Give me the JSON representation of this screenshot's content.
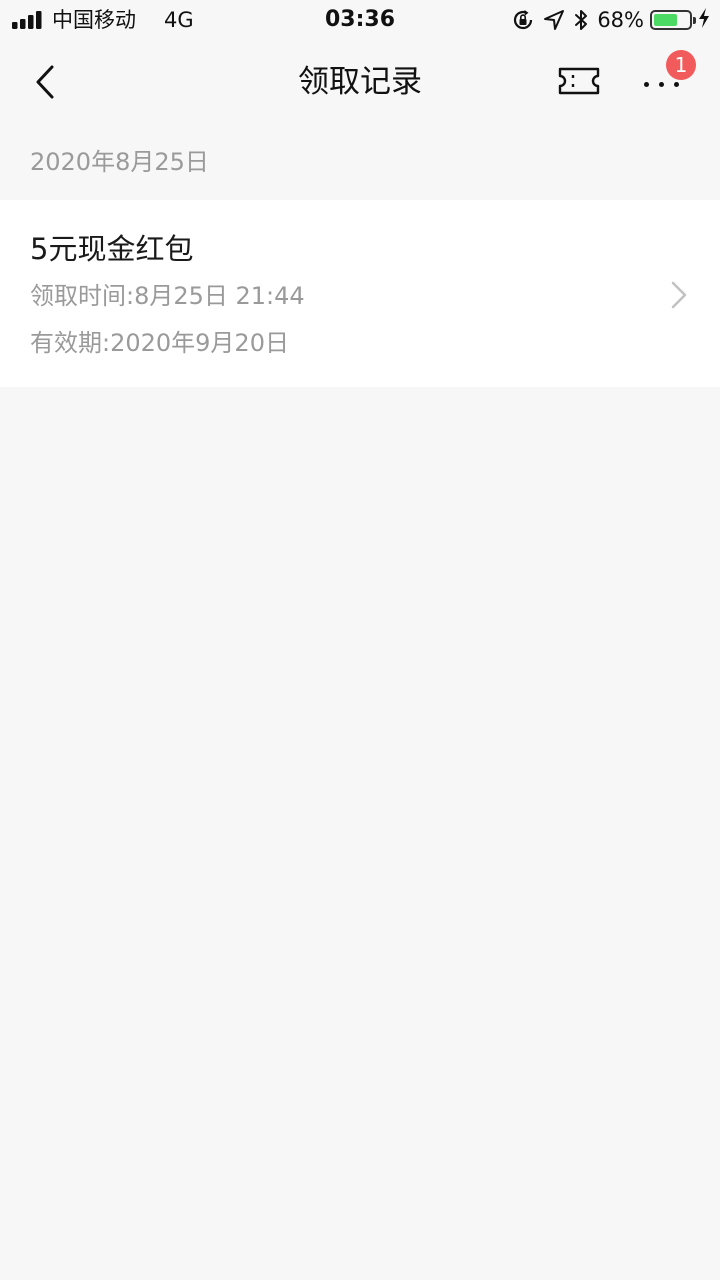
{
  "status_bar": {
    "carrier": "中国移动",
    "network": "4G",
    "time": "03:36",
    "battery_percent": "68%",
    "battery_level": 0.68,
    "battery_color": "#4cd964",
    "icons": [
      "signal-icon",
      "rotation-lock-icon",
      "location-arrow-icon",
      "bluetooth-icon",
      "battery-icon",
      "charging-icon"
    ]
  },
  "nav": {
    "title": "领取记录",
    "back_icon": "chevron-left-icon",
    "ticket_icon": "ticket-icon",
    "more_icon": "more-dots-icon",
    "badge_count": "1",
    "badge_color": "#f25b5b"
  },
  "section": {
    "date": "2020年8月25日"
  },
  "record": {
    "title": "5元现金红包",
    "claim_time": "领取时间:8月25日 21:44",
    "expiry": "有效期:2020年9月20日",
    "chevron_icon": "chevron-right-icon"
  }
}
